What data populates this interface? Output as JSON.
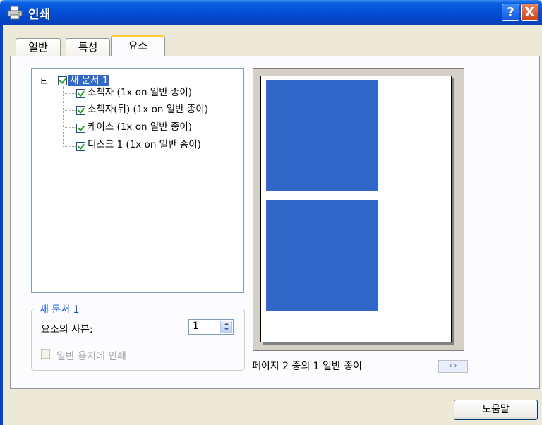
{
  "window": {
    "title": "인쇄",
    "help_glyph": "?",
    "close_glyph": "X"
  },
  "tabs": [
    {
      "label": "일반",
      "active": false
    },
    {
      "label": "특성",
      "active": false
    },
    {
      "label": "요소",
      "active": true
    }
  ],
  "tree": {
    "root": {
      "label": "새 문서 1",
      "checked": true,
      "expanded": true,
      "selected": true
    },
    "children": [
      {
        "label": "소책자 (1x on 일반 종이)",
        "checked": true
      },
      {
        "label": "소책자(뒤) (1x on 일반 종이)",
        "checked": true
      },
      {
        "label": "케이스 (1x on 일반 종이)",
        "checked": true
      },
      {
        "label": "디스크 1 (1x on 일반 종이)",
        "checked": true
      }
    ]
  },
  "document_group": {
    "title": "새 문서 1",
    "copies_label": "요소의 사본:",
    "copies_value": "1",
    "print_plain_paper_label": "일반 용지에 인쇄",
    "print_plain_paper_checked": false,
    "print_plain_paper_enabled": false
  },
  "preview": {
    "status": "페이지 2 중의 1 일반 종이",
    "nav_glyph": "‹ ›",
    "element_color": "#3167c6"
  },
  "footer": {
    "help_button": "도움말"
  }
}
